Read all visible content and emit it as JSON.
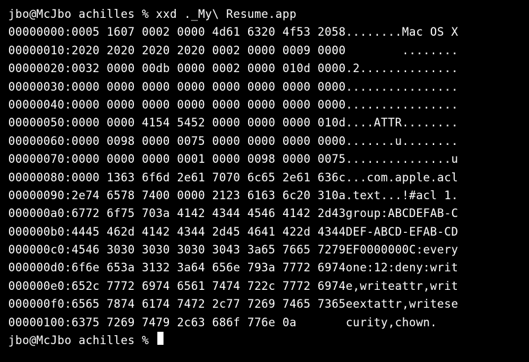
{
  "prompt1": {
    "user": "jbo@McJbo",
    "host": "achilles",
    "symbol": "%",
    "command": "xxd ._My\\ Resume.app"
  },
  "prompt2": {
    "user": "jbo@McJbo",
    "host": "achilles",
    "symbol": "%"
  },
  "rows": [
    {
      "offset": "00000000:",
      "hex": "0005 1607 0002 0000 4d61 6320 4f53 2058",
      "ascii": "........Mac OS X"
    },
    {
      "offset": "00000010:",
      "hex": "2020 2020 2020 2020 0002 0000 0009 0000",
      "ascii": "        ........"
    },
    {
      "offset": "00000020:",
      "hex": "0032 0000 00db 0000 0002 0000 010d 0000",
      "ascii": ".2.............."
    },
    {
      "offset": "00000030:",
      "hex": "0000 0000 0000 0000 0000 0000 0000 0000",
      "ascii": "................"
    },
    {
      "offset": "00000040:",
      "hex": "0000 0000 0000 0000 0000 0000 0000 0000",
      "ascii": "................"
    },
    {
      "offset": "00000050:",
      "hex": "0000 0000 4154 5452 0000 0000 0000 010d",
      "ascii": "....ATTR........"
    },
    {
      "offset": "00000060:",
      "hex": "0000 0098 0000 0075 0000 0000 0000 0000",
      "ascii": ".......u........"
    },
    {
      "offset": "00000070:",
      "hex": "0000 0000 0000 0001 0000 0098 0000 0075",
      "ascii": "...............u"
    },
    {
      "offset": "00000080:",
      "hex": "0000 1363 6f6d 2e61 7070 6c65 2e61 636c",
      "ascii": "...com.apple.acl"
    },
    {
      "offset": "00000090:",
      "hex": "2e74 6578 7400 0000 2123 6163 6c20 310a",
      "ascii": ".text...!#acl 1."
    },
    {
      "offset": "000000a0:",
      "hex": "6772 6f75 703a 4142 4344 4546 4142 2d43",
      "ascii": "group:ABCDEFAB-C"
    },
    {
      "offset": "000000b0:",
      "hex": "4445 462d 4142 4344 2d45 4641 422d 4344",
      "ascii": "DEF-ABCD-EFAB-CD"
    },
    {
      "offset": "000000c0:",
      "hex": "4546 3030 3030 3030 3043 3a65 7665 7279",
      "ascii": "EF0000000C:every"
    },
    {
      "offset": "000000d0:",
      "hex": "6f6e 653a 3132 3a64 656e 793a 7772 6974",
      "ascii": "one:12:deny:writ"
    },
    {
      "offset": "000000e0:",
      "hex": "652c 7772 6974 6561 7474 722c 7772 6974",
      "ascii": "e,writeattr,writ"
    },
    {
      "offset": "000000f0:",
      "hex": "6565 7874 6174 7472 2c77 7269 7465 7365",
      "ascii": "eextattr,writese"
    },
    {
      "offset": "00000100:",
      "hex": "6375 7269 7479 2c63 686f 776e 0a       ",
      "ascii": "curity,chown."
    }
  ]
}
